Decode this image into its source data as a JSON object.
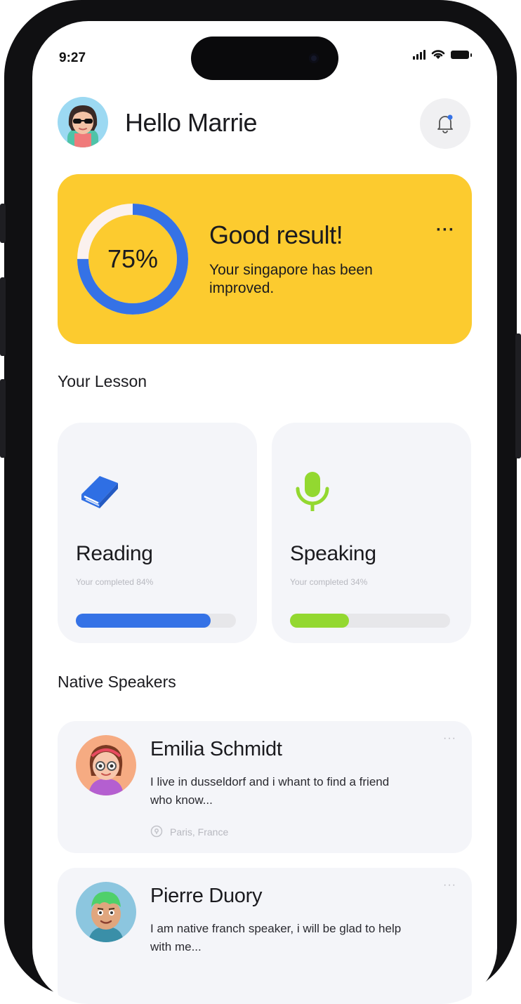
{
  "status_bar": {
    "time": "9:27"
  },
  "header": {
    "greeting": "Hello Marrie"
  },
  "result_card": {
    "percent_label": "75%",
    "progress": 0.75,
    "title": "Good result!",
    "description": "Your singapore has been improved.",
    "more_label": "···"
  },
  "lessons": {
    "title": "Your Lesson",
    "items": [
      {
        "name": "Reading",
        "subtitle": "Your completed 84%",
        "progress": 0.84,
        "color": "#3572e6",
        "icon": "book-icon"
      },
      {
        "name": "Speaking",
        "subtitle": "Your completed 34%",
        "progress": 0.37,
        "color": "#93d830",
        "icon": "microphone-icon"
      }
    ]
  },
  "speakers": {
    "title": "Native Speakers",
    "items": [
      {
        "name": "Emilia Schmidt",
        "bio": "I live in dusseldorf and i whant to find a friend who know...",
        "location": "Paris, France",
        "more_label": "···"
      },
      {
        "name": "Pierre Duory",
        "bio": "I am native franch speaker, i will be glad to help with me...",
        "more_label": "···"
      }
    ]
  },
  "colors": {
    "accent_yellow": "#fccb2f",
    "accent_blue": "#3572e6",
    "accent_green": "#93d830",
    "card_bg": "#f4f5f9"
  }
}
